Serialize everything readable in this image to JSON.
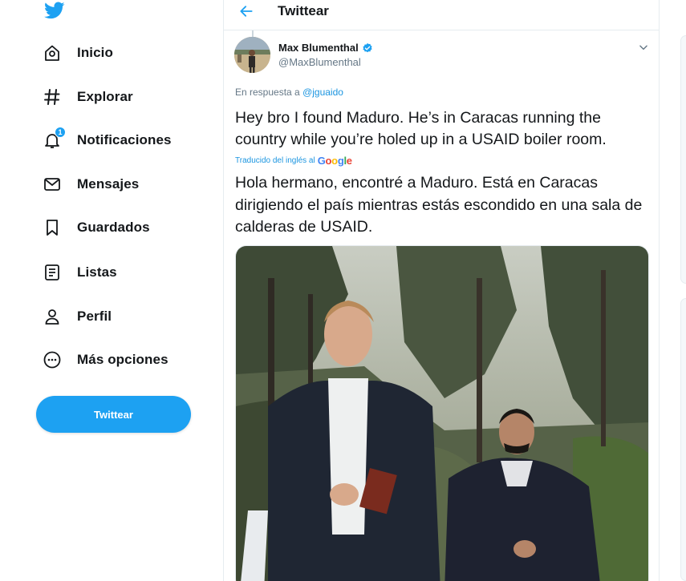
{
  "nav": {
    "items": [
      {
        "id": "home",
        "label": "Inicio",
        "icon": "home-icon"
      },
      {
        "id": "explore",
        "label": "Explorar",
        "icon": "hashtag-icon"
      },
      {
        "id": "notifications",
        "label": "Notificaciones",
        "icon": "bell-icon",
        "badge": "1"
      },
      {
        "id": "messages",
        "label": "Mensajes",
        "icon": "envelope-icon"
      },
      {
        "id": "bookmarks",
        "label": "Guardados",
        "icon": "bookmark-icon"
      },
      {
        "id": "lists",
        "label": "Listas",
        "icon": "list-icon"
      },
      {
        "id": "profile",
        "label": "Perfil",
        "icon": "person-icon"
      },
      {
        "id": "more",
        "label": "Más opciones",
        "icon": "more-circle-icon"
      }
    ],
    "tweet_button": "Twittear"
  },
  "header": {
    "title": "Twittear"
  },
  "tweet": {
    "author_name": "Max Blumenthal",
    "author_handle": "@MaxBlumenthal",
    "reply_prefix": "En respuesta a ",
    "reply_mention": "@jguaido",
    "text": "Hey bro I found Maduro. He’s in Caracas running the country while you’re holed up in a USAID boiler room.",
    "translated_by": "Traducido del inglés al",
    "translator": "Google",
    "translation": "Hola hermano, encontré a Maduro. Está en Caracas dirigiendo el país mientras estás escondido en una sala de calderas de USAID."
  },
  "colors": {
    "accent": "#1da1f2",
    "text": "#14171a",
    "muted": "#657786",
    "link": "#1b95e0",
    "border": "#e6ecf0"
  }
}
